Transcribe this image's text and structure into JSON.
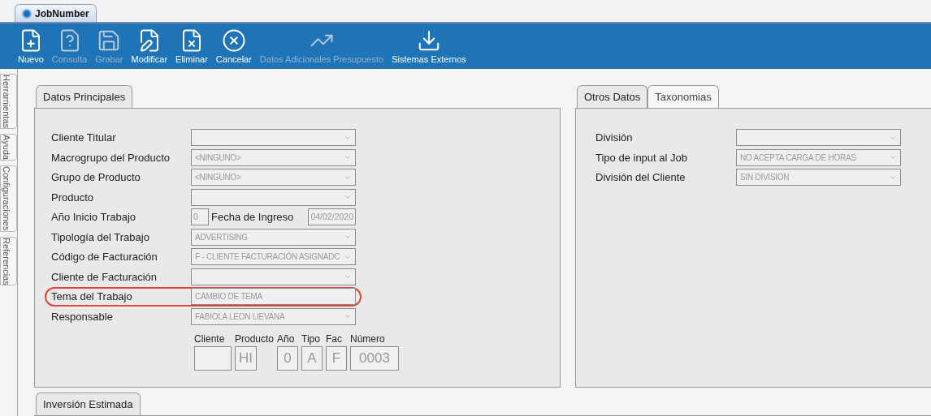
{
  "window_tab": {
    "title": "JobNumber"
  },
  "toolbar": [
    {
      "kind": "new",
      "label": "Nuevo",
      "disabled": false
    },
    {
      "kind": "query",
      "label": "Consulta",
      "disabled": true
    },
    {
      "kind": "save",
      "label": "Grabar",
      "disabled": true
    },
    {
      "kind": "edit",
      "label": "Modificar",
      "disabled": false
    },
    {
      "kind": "delete",
      "label": "Eliminar",
      "disabled": false
    },
    {
      "kind": "cancel",
      "label": "Cancelar",
      "disabled": false
    },
    {
      "kind": "chart",
      "label": "Datos Adicionales Presupuesto",
      "disabled": true
    },
    {
      "kind": "external",
      "label": "Sistemas Externos",
      "disabled": false
    }
  ],
  "side_tabs": [
    "Herramientas",
    "Ayuda",
    "Configuraciones",
    "Referencias"
  ],
  "main_panel": {
    "tabs": [
      {
        "label": "Datos Principales",
        "selected": true
      }
    ],
    "fields": [
      {
        "kind": "select",
        "label": "Cliente Titular",
        "highlighted": false
      },
      {
        "kind": "select",
        "label": "Macrogrupo del Producto",
        "value": "<NINGUNO>",
        "highlighted": false
      },
      {
        "kind": "select",
        "label": "Grupo de Producto",
        "value": "<NINGUNO>",
        "highlighted": false
      },
      {
        "kind": "select",
        "label": "Producto",
        "highlighted": false
      },
      {
        "kind": "year_date",
        "label": "Año Inicio Trabajo",
        "value": "0",
        "date_label": "Fecha de Ingreso",
        "date_value": "04/02/2020",
        "highlighted": false
      },
      {
        "kind": "select",
        "label": "Tipología del Trabajo",
        "value": "ADVERTISING",
        "highlighted": false
      },
      {
        "kind": "select",
        "label": "Código de Facturación",
        "value": "F - CLIENTE FACTURACIÓN ASIGNADC",
        "highlighted": false
      },
      {
        "kind": "select",
        "label": "Cliente de Facturación",
        "highlighted": false
      },
      {
        "kind": "text",
        "label": "Tema del Trabajo",
        "value": "CAMBIO DE TEMA",
        "highlighted": true
      },
      {
        "kind": "select",
        "label": "Responsable",
        "value": "FABIOLA LEON LIEVANA",
        "highlighted": false
      }
    ],
    "code_parts": [
      {
        "label": "Cliente"
      },
      {
        "label": "Producto",
        "value": "HI"
      },
      {
        "label": "Año",
        "value": "0"
      },
      {
        "label": "Tipo",
        "value": "A"
      },
      {
        "label": "Fac",
        "value": "F"
      },
      {
        "label": "Número",
        "value": "0003"
      }
    ]
  },
  "side_panel": {
    "tabs": [
      {
        "label": "Otros Datos",
        "selected": true
      },
      {
        "label": "Taxonomias",
        "selected": false
      }
    ],
    "fields": [
      {
        "label": "División"
      },
      {
        "label": "Tipo de input al Job",
        "value": "NO ACEPTA CARGA DE HORAS"
      },
      {
        "label": "División del Cliente",
        "value": "SIN DIVISION"
      }
    ]
  },
  "bottom_panel": {
    "tabs": [
      {
        "label": "Inversión Estimada",
        "selected": true
      }
    ]
  }
}
